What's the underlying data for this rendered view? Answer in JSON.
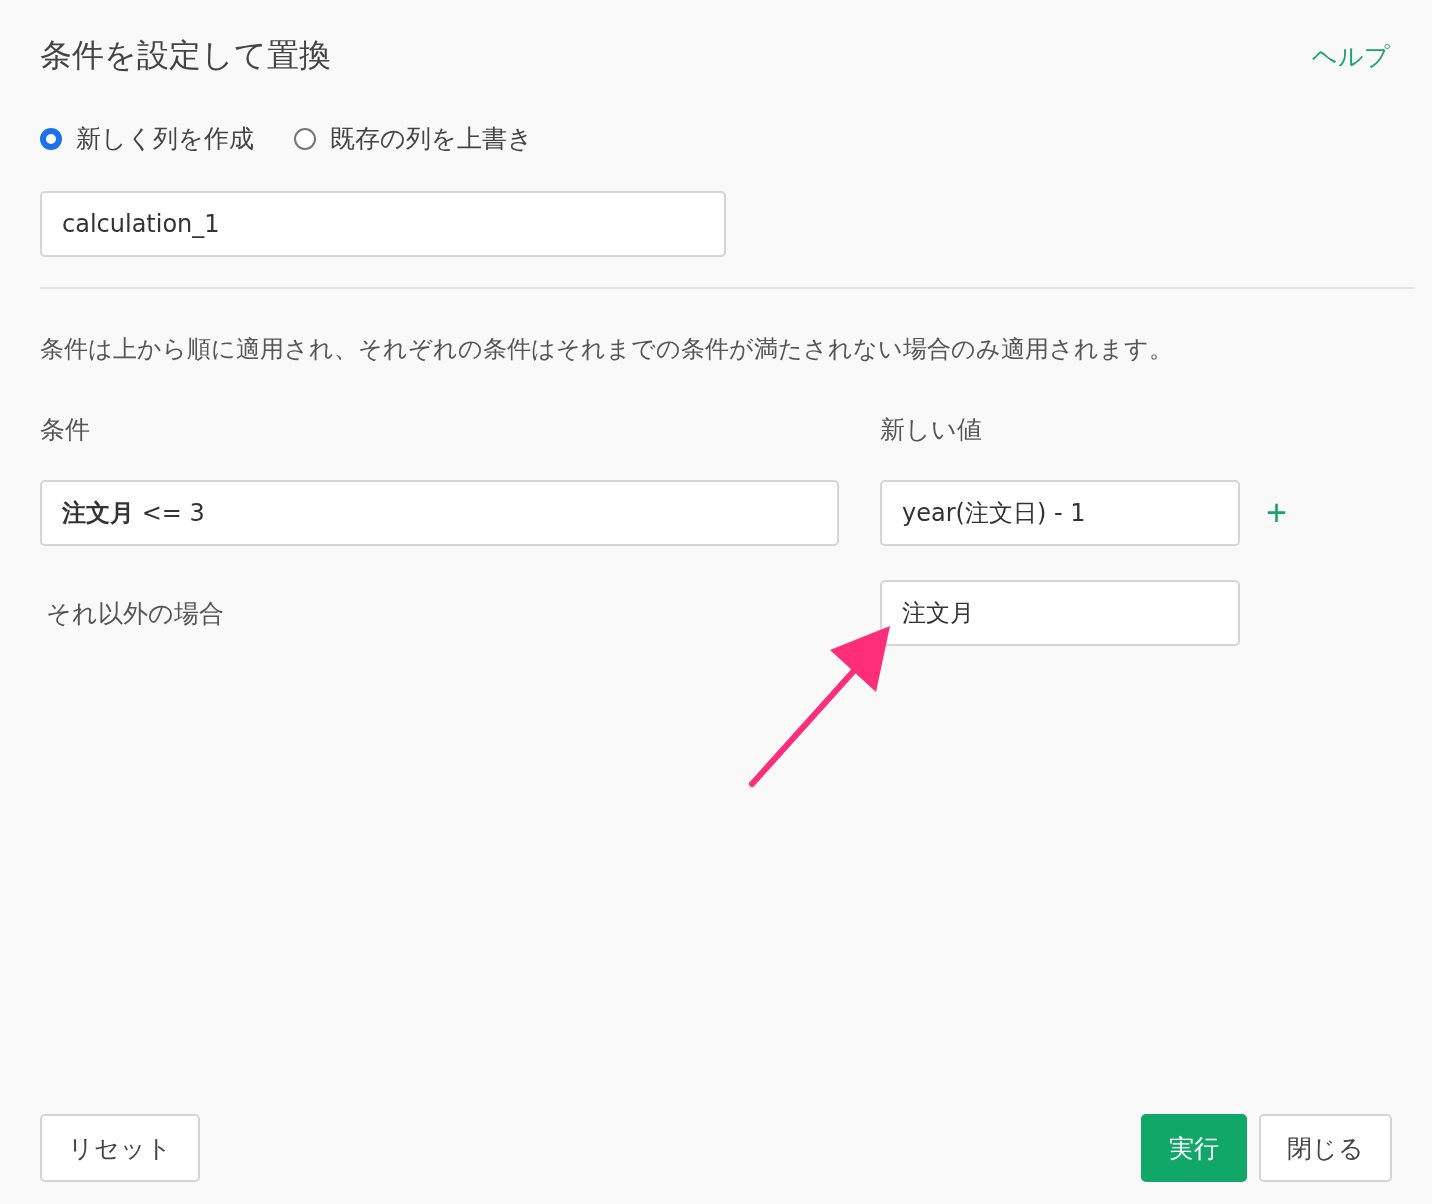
{
  "dialog": {
    "title": "条件を設定して置換",
    "help_link": "ヘルプ"
  },
  "mode_options": [
    {
      "label": "新しく列を作成",
      "selected": true
    },
    {
      "label": "既存の列を上書き",
      "selected": false
    }
  ],
  "column_name": {
    "value": "calculation_1"
  },
  "description": "条件は上から順に適用され、それぞれの条件はそれまでの条件が満たされない場合のみ適用されます。",
  "columns": {
    "condition": "条件",
    "new_value": "新しい値"
  },
  "rules": [
    {
      "condition": "**注文月** <= 3",
      "value": "year(注文日) - 1",
      "add_button": "+"
    }
  ],
  "otherwise": {
    "label": "それ以外の場合",
    "value": "注文月"
  },
  "buttons": {
    "reset": "リセット",
    "run": "実行",
    "close": "閉じる"
  }
}
